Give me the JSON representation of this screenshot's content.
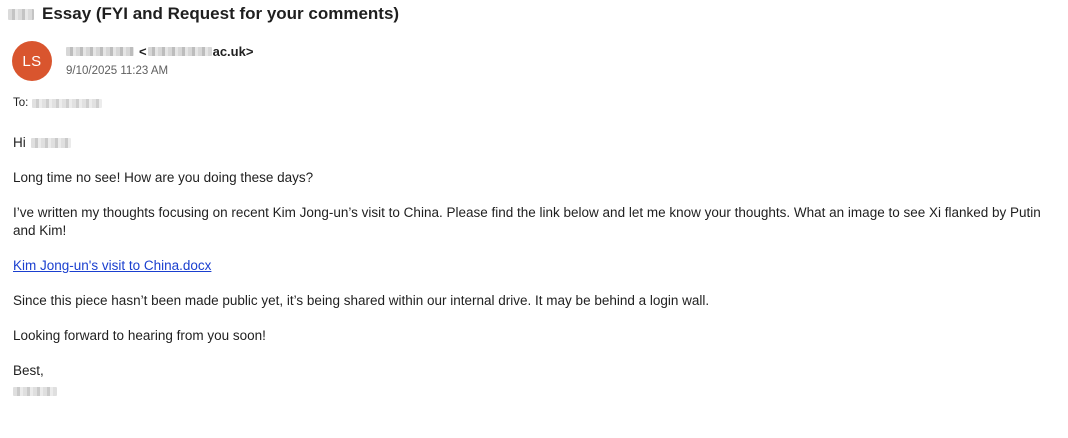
{
  "email": {
    "subject": "Essay (FYI and Request for your comments)",
    "avatar_initials": "LS",
    "avatar_color": "#d9552e",
    "sender_prefix": "<",
    "sender_domain_suffix": "ac.uk>",
    "date": "9/10/2025 11:23 AM",
    "to_label": "To:",
    "greeting": "Hi",
    "paragraphs": [
      "Long time no see! How are you doing these days?",
      "I’ve written my thoughts focusing on recent Kim Jong-un’s visit to China. Please find the link below and let me know your thoughts. What an image to see Xi flanked by Putin and Kim!"
    ],
    "link_text": "Kim Jong-un's visit to China.docx",
    "link_color": "#1a3fcf",
    "after_link": [
      "Since this piece hasn’t been made public yet, it’s being shared within our internal drive. It may be behind a login wall.",
      "Looking forward to hearing from you soon!"
    ],
    "signoff": "Best,"
  }
}
